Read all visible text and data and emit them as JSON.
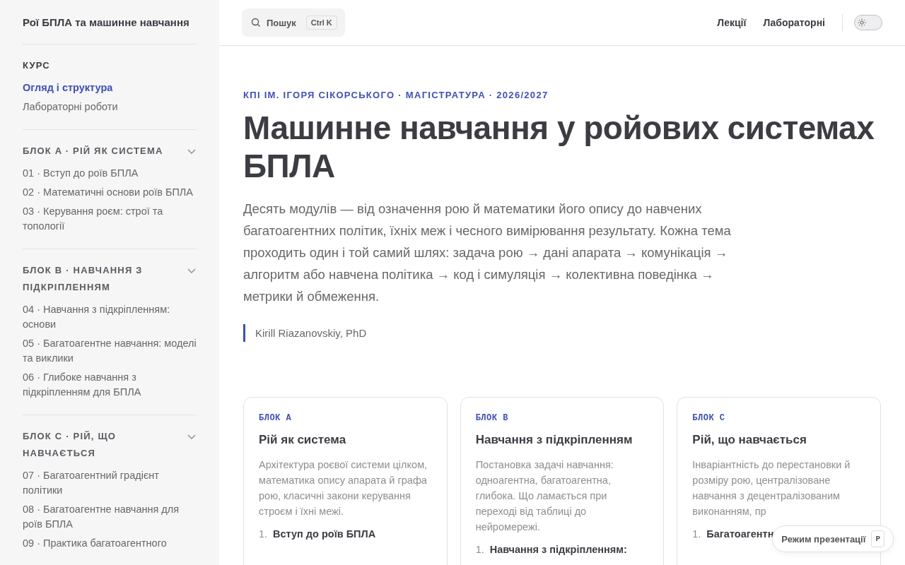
{
  "sidebar": {
    "title": "Рої БПЛА та машинне навчання",
    "sections": [
      {
        "heading": "КУРС",
        "collapsible": false,
        "items": [
          {
            "label": "Огляд і структура",
            "selected": true
          },
          {
            "label": "Лабораторні роботи",
            "selected": false
          }
        ]
      },
      {
        "heading": "БЛОК A · РІЙ ЯК СИСТЕМА",
        "collapsible": true,
        "items": [
          {
            "label": "01 · Вступ до роїв БПЛА",
            "selected": false
          },
          {
            "label": "02 · Математичні основи роїв БПЛА",
            "selected": false
          },
          {
            "label": "03 · Керування роєм: строї та топології",
            "selected": false
          }
        ]
      },
      {
        "heading": "БЛОК B · НАВЧАННЯ З ПІДКРІПЛЕННЯМ",
        "collapsible": true,
        "items": [
          {
            "label": "04 · Навчання з підкріпленням: основи",
            "selected": false
          },
          {
            "label": "05 · Багатоагентне навчання: моделі та виклики",
            "selected": false
          },
          {
            "label": "06 · Глибоке навчання з підкріпленням для БПЛА",
            "selected": false
          }
        ]
      },
      {
        "heading": "БЛОК C · РІЙ, ЩО НАВЧАЄТЬСЯ",
        "collapsible": true,
        "items": [
          {
            "label": "07 · Багатоагентний градієнт політики",
            "selected": false
          },
          {
            "label": "08 · Багатоагентне навчання для роїв БПЛА",
            "selected": false
          },
          {
            "label": "09 · Практика багатоагентного",
            "selected": false
          }
        ]
      }
    ]
  },
  "topbar": {
    "search": {
      "placeholder": "Пошук",
      "shortcut": "Ctrl K"
    },
    "nav": [
      "Лекції",
      "Лабораторні"
    ],
    "theme_toggle": {
      "on": false
    }
  },
  "hero": {
    "eyebrow": "КПІ ІМ. ІГОРЯ СІКОРСЬКОГО · МАГІСТРАТУРА · 2026/2027",
    "title": "Машинне навчання у ройових системах БПЛА",
    "lead": "Десять модулів — від означення рою й математики його опису до навчених багатоагентних політик, їхніх меж і чесного вимірювання результату. Кожна тема проходить один і той самий шлях: задача рою → дані апарата → комунікація → алгоритм або навчена політика → код і симуляція → колективна поведінка → метрики й обмеження.",
    "author": "Kirill Riazanovskiy, PhD"
  },
  "cards": [
    {
      "tag": "БЛОК A",
      "title": "Рій як система",
      "text": "Архітектура роєвої системи цілком, математика опису апарата й графа рою, класичні закони керування строєм і їхні межі.",
      "items": [
        {
          "number": "1.",
          "label": "Вступ до роїв БПЛА"
        }
      ]
    },
    {
      "tag": "БЛОК B",
      "title": "Навчання з підкріпленням",
      "text": "Постановка задачі навчання: одноагентна, багатоагентна, глибока. Що ламається при переході від таблиці до нейромережі.",
      "items": [
        {
          "number": "1.",
          "label": "Навчання з підкріпленням:"
        }
      ]
    },
    {
      "tag": "БЛОК C",
      "title": "Рій, що навчається",
      "text": "Інваріантність до перестановки й розміру рою, централізоване навчання з децентралізованим виконанням, пр",
      "items": [
        {
          "number": "1.",
          "label": "Багатоагентн"
        }
      ]
    }
  ],
  "presentation_button": {
    "label": "Режим презентації",
    "key": "P"
  }
}
